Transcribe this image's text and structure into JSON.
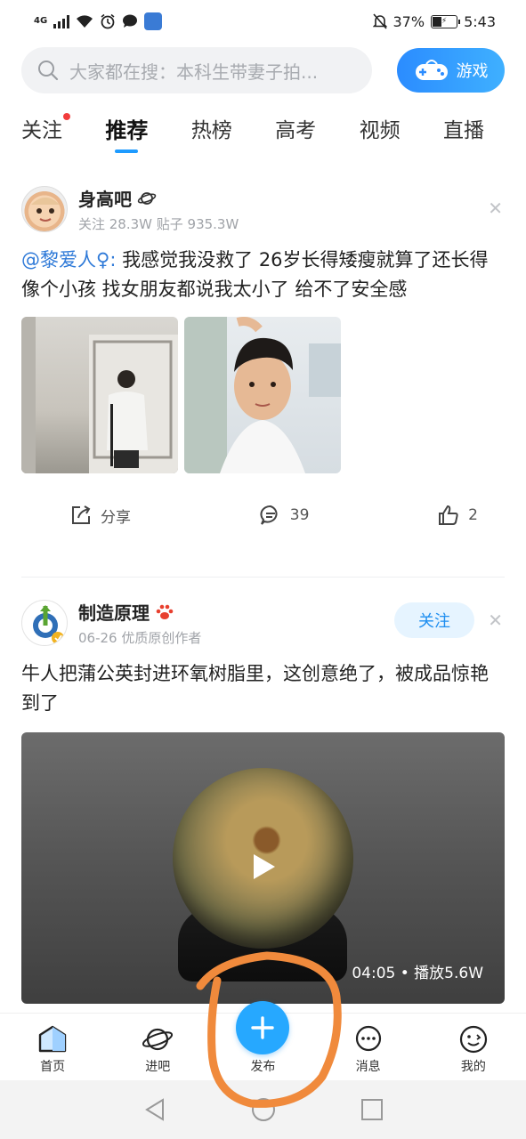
{
  "status_bar": {
    "network": "4G",
    "battery_percent": "37%",
    "battery_level": 0.37,
    "time": "5:43"
  },
  "search": {
    "placeholder": "大家都在搜：本科生带妻子拍...",
    "game_label": "游戏"
  },
  "tabs": [
    {
      "label": "关注",
      "has_dot": true
    },
    {
      "label": "推荐",
      "active": true
    },
    {
      "label": "热榜"
    },
    {
      "label": "高考"
    },
    {
      "label": "视频"
    },
    {
      "label": "直播"
    }
  ],
  "post1": {
    "author": "身高吧",
    "meta": "关注 28.3W  贴子 935.3W",
    "mention": "@黎爱人♀:",
    "text": " 我感觉我没救了 26岁长得矮瘦就算了还长得像个小孩 找女朋友都说我太小了 给不了安全感",
    "share_label": "分享",
    "comment_count": "39",
    "like_count": "2"
  },
  "post2": {
    "author": "制造原理",
    "meta": "06-26  优质原创作者",
    "follow_label": "关注",
    "text": "牛人把蒲公英封进环氧树脂里，这创意绝了，被成品惊艳到了",
    "video_meta": "04:05 • 播放5.6W"
  },
  "tabbar": [
    {
      "label": "首页"
    },
    {
      "label": "进吧"
    },
    {
      "label": "发布"
    },
    {
      "label": "消息"
    },
    {
      "label": "我的"
    }
  ],
  "colors": {
    "accent": "#1e9bff",
    "annotation": "#f08a3c"
  }
}
